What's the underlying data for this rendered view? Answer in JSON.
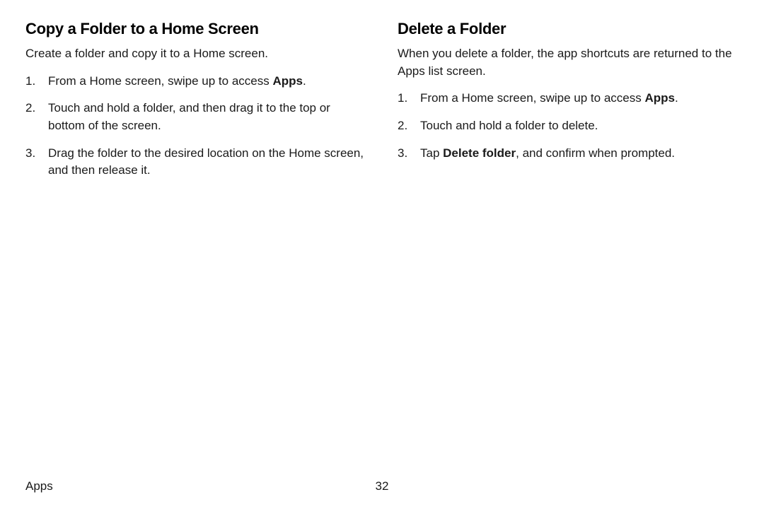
{
  "left": {
    "heading": "Copy a Folder to a Home Screen",
    "intro": "Create a folder and copy it to a Home screen.",
    "steps": {
      "s1_pre": "From a Home screen, swipe up to access ",
      "s1_bold": "Apps",
      "s1_post": ".",
      "s2": "Touch and hold a folder, and then drag it to the top or bottom of the screen.",
      "s3": "Drag the folder to the desired location on the Home screen, and then release it."
    }
  },
  "right": {
    "heading": "Delete a Folder",
    "intro": "When you delete a folder, the app shortcuts are returned to the Apps list screen.",
    "steps": {
      "s1_pre": "From a Home screen, swipe up to access ",
      "s1_bold": "Apps",
      "s1_post": ".",
      "s2": "Touch and hold a folder to delete.",
      "s3_pre": "Tap ",
      "s3_bold": "Delete folder",
      "s3_post": ", and confirm when prompted."
    }
  },
  "footer": {
    "section": "Apps",
    "page": "32"
  }
}
